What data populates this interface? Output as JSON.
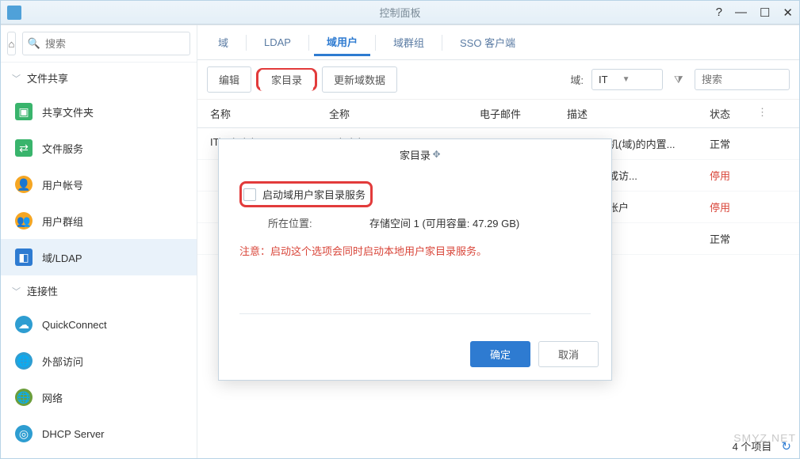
{
  "window": {
    "title": "控制面板"
  },
  "sidebar": {
    "search_placeholder": "搜索",
    "sections": [
      {
        "label": "文件共享"
      },
      {
        "label": "连接性"
      }
    ],
    "items": [
      {
        "label": "共享文件夹"
      },
      {
        "label": "文件服务"
      },
      {
        "label": "用户帐号"
      },
      {
        "label": "用户群组"
      },
      {
        "label": "域/LDAP"
      },
      {
        "label": "QuickConnect"
      },
      {
        "label": "外部访问"
      },
      {
        "label": "网络"
      },
      {
        "label": "DHCP Server"
      }
    ]
  },
  "tabs": {
    "items": [
      "域",
      "LDAP",
      "域用户",
      "域群组",
      "SSO 客户端"
    ],
    "active": "域用户"
  },
  "toolbar": {
    "edit": "编辑",
    "home_dir": "家目录",
    "refresh_domain": "更新域数据",
    "domain_label": "域:",
    "domain_value": "IT",
    "search_placeholder": "搜索"
  },
  "table": {
    "headers": {
      "name": "名称",
      "full": "全称",
      "email": "电子邮件",
      "desc": "描述",
      "status": "状态"
    },
    "rows": [
      {
        "name": "IT\\Administrator",
        "full": "Administrator",
        "email": "",
        "desc": "管理计算机(域)的内置...",
        "status": "正常",
        "status_class": "status-normal"
      },
      {
        "name": "",
        "full": "",
        "email": "",
        "desc": "间计算机或访...",
        "status": "停用",
        "status_class": "status-disabled"
      },
      {
        "name": "",
        "full": "",
        "email": "",
        "desc": "中心服务帐户",
        "status": "停用",
        "status_class": "status-disabled"
      },
      {
        "name": "",
        "full": "",
        "email": "",
        "desc": "理",
        "status": "正常",
        "status_class": "status-normal"
      }
    ]
  },
  "footer": {
    "count": "4 个项目"
  },
  "dialog": {
    "title": "家目录",
    "checkbox_label": "启动域用户家目录服务",
    "location_label": "所在位置:",
    "location_value": "存储空间 1 (可用容量: 47.29 GB)",
    "warning": "注意：启动这个选项会同时启动本地用户家目录服务。",
    "ok": "确定",
    "cancel": "取消"
  },
  "watermark": "SMYZ.NET"
}
